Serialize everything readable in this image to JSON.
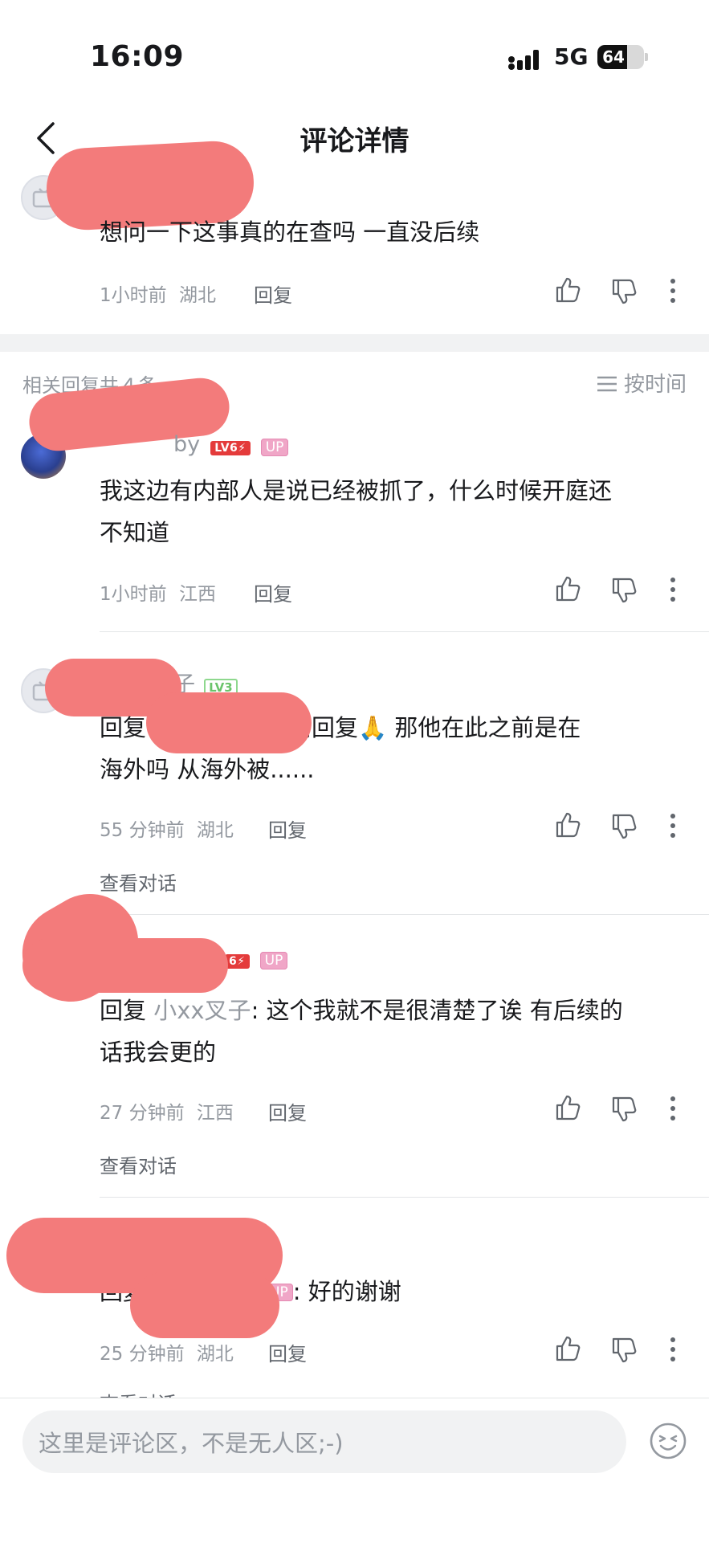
{
  "status_bar": {
    "time": "16:09",
    "network": "5G",
    "battery": "64",
    "battery_level": 0.64
  },
  "nav": {
    "title": "评论详情"
  },
  "root_comment": {
    "text": "想问一下这事真的在查吗 一直没后续",
    "time": "1小时前",
    "location": "湖北",
    "reply_label": "回复"
  },
  "replies_header": {
    "count_label": "相关回复共４条",
    "sort_label": "按时间"
  },
  "replies": [
    {
      "name_fragment": "by",
      "level_badge": "LV6⚡",
      "up_badge": "UP",
      "text": "我这边有内部人是说已经被抓了，什么时候开庭还不知道",
      "line1": "我这边有内部人是说已经被抓了，什么时候开庭还",
      "line2": "不知道",
      "time": "1小时前",
      "location": "江西",
      "reply_label": "回复"
    },
    {
      "name_fragment": "子",
      "level_badge": "LV3",
      "reply_prefix": "回复",
      "line1": "感谢回复🙏 那他在此之前是在",
      "line2": "海外吗 从海外被......",
      "time": "55 分钟前",
      "location": "湖北",
      "reply_label": "回复",
      "view_conversation": "查看对话"
    },
    {
      "level_badge": "6⚡",
      "up_badge": "UP",
      "reply_prefix": "回复",
      "reply_to": "小xx叉子",
      "line1": ": 这个我就不是很清楚了诶 有后续的",
      "line2": "话我会更的",
      "time": "27 分钟前",
      "location": "江西",
      "reply_label": "回复",
      "view_conversation": "查看对话"
    },
    {
      "up_badge": "UP",
      "reply_prefix": "回复",
      "text": ": 好的谢谢",
      "time": "25 分钟前",
      "location": "湖北",
      "reply_label": "回复",
      "view_conversation": "查看对话"
    }
  ],
  "input": {
    "placeholder": "这里是评论区，不是无人区;-)"
  },
  "icons": [
    "back-icon",
    "like-icon",
    "dislike-icon",
    "more-icon",
    "sort-icon",
    "emoji-icon",
    "default-avatar-icon"
  ]
}
